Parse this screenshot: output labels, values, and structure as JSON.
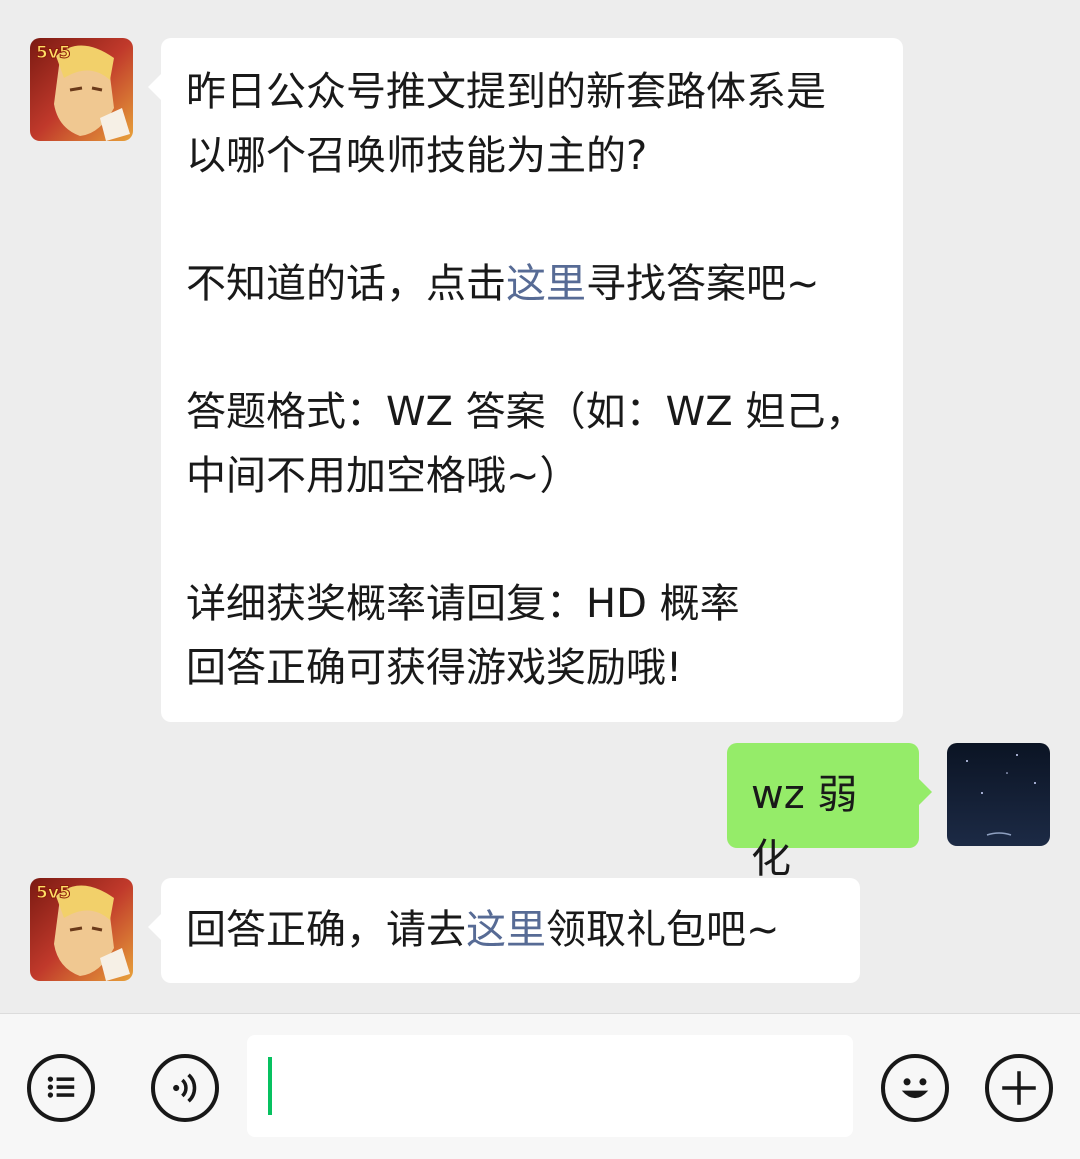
{
  "messages": [
    {
      "sender": "honor-of-kings-official",
      "avatar_icon": "game-logo-5v5",
      "avatar_badge": "5v5",
      "paragraphs": [
        {
          "lines": [
            "昨日公众号推文提到的新套路体系是",
            "以哪个召唤师技能为主的?"
          ]
        },
        {
          "lines": [
            {
              "before": "不知道的话，点击",
              "link": "这里",
              "after": "寻找答案吧~"
            }
          ]
        },
        {
          "lines": [
            "答题格式：WZ 答案（如：WZ 妲己，",
            "中间不用加空格哦~）"
          ]
        },
        {
          "lines": [
            "详细获奖概率请回复：HD 概率",
            "回答正确可获得游戏奖励哦!"
          ]
        }
      ]
    },
    {
      "sender": "me",
      "avatar_icon": "night-moon-avatar",
      "text": "wz 弱化"
    },
    {
      "sender": "honor-of-kings-official",
      "avatar_icon": "game-logo-5v5",
      "avatar_badge": "5v5",
      "before": "回答正确，请去",
      "link": "这里",
      "after": "领取礼包吧~"
    }
  ],
  "input_bar": {
    "left_icons": [
      "menu-list-icon",
      "voice-icon"
    ],
    "right_icons": [
      "emoji-icon",
      "plus-icon"
    ],
    "input_value": ""
  },
  "colors": {
    "background": "#ededed",
    "incoming_bubble": "#ffffff",
    "outgoing_bubble": "#95ec69",
    "link": "#576b95",
    "caret": "#07c160"
  }
}
